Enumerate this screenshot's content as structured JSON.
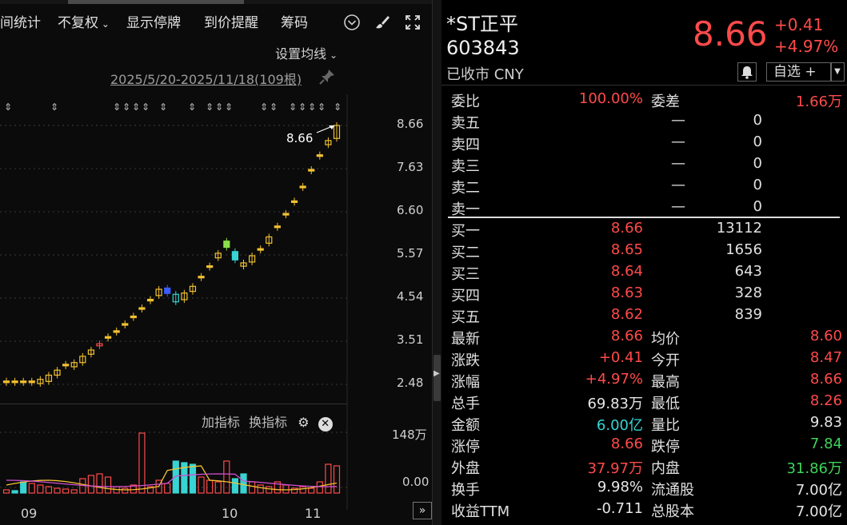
{
  "toolbar": {
    "items": [
      "间统计",
      "不复权",
      "显示停牌",
      "到价提醒",
      "筹码"
    ],
    "ma_setting": "设置均线",
    "date_range": "2025/5/20-2025/11/18(109根)"
  },
  "chart": {
    "price_ticks": [
      "8.66",
      "7.63",
      "6.60",
      "5.57",
      "4.54",
      "3.51",
      "2.48"
    ],
    "last_price_label": "8.66",
    "indicator_add": "加指标",
    "indicator_switch": "换指标",
    "volume_top": "148万",
    "volume_zero": "0.00",
    "x_labels": [
      "09",
      "10",
      "11"
    ],
    "expand": "»"
  },
  "chart_data": {
    "type": "candlestick",
    "ylim": [
      2.48,
      8.66
    ],
    "candles": [
      {
        "o": 2.56,
        "c": 2.56
      },
      {
        "o": 2.56,
        "c": 2.56
      },
      {
        "o": 2.56,
        "c": 2.56
      },
      {
        "o": 2.56,
        "c": 2.56
      },
      {
        "o": 2.5,
        "c": 2.6
      },
      {
        "o": 2.55,
        "c": 2.7
      },
      {
        "o": 2.7,
        "c": 2.82
      },
      {
        "o": 2.95,
        "c": 2.96
      },
      {
        "o": 2.9,
        "c": 3.0
      },
      {
        "o": 3.0,
        "c": 3.15
      },
      {
        "o": 3.2,
        "c": 3.3
      },
      {
        "o": 3.4,
        "c": 3.45
      },
      {
        "o": 3.6,
        "c": 3.62
      },
      {
        "o": 3.75,
        "c": 3.76
      },
      {
        "o": 3.92,
        "c": 3.93
      },
      {
        "o": 4.1,
        "c": 4.11
      },
      {
        "o": 4.3,
        "c": 4.31
      },
      {
        "o": 4.5,
        "c": 4.51
      },
      {
        "o": 4.6,
        "c": 4.75
      },
      {
        "o": 4.78,
        "c": 4.65
      },
      {
        "o": 4.45,
        "c": 4.63
      },
      {
        "o": 4.5,
        "c": 4.66
      },
      {
        "o": 4.7,
        "c": 4.82
      },
      {
        "o": 5.05,
        "c": 5.06
      },
      {
        "o": 5.3,
        "c": 5.31
      },
      {
        "o": 5.5,
        "c": 5.61
      },
      {
        "o": 5.9,
        "c": 5.75
      },
      {
        "o": 5.65,
        "c": 5.45
      },
      {
        "o": 5.3,
        "c": 5.38
      },
      {
        "o": 5.4,
        "c": 5.55
      },
      {
        "o": 5.7,
        "c": 5.72
      },
      {
        "o": 5.85,
        "c": 6.0
      },
      {
        "o": 6.25,
        "c": 6.26
      },
      {
        "o": 6.55,
        "c": 6.56
      },
      {
        "o": 6.85,
        "c": 6.86
      },
      {
        "o": 7.2,
        "c": 7.21
      },
      {
        "o": 7.6,
        "c": 7.61
      },
      {
        "o": 7.95,
        "c": 7.96
      },
      {
        "o": 8.2,
        "c": 8.3
      },
      {
        "o": 8.35,
        "c": 8.66
      }
    ],
    "volume_range": [
      0,
      1480000
    ]
  },
  "quote": {
    "name": "*ST正平",
    "code": "603843",
    "status": "已收市 CNY",
    "price": "8.66",
    "change": "+0.41",
    "change_pct": "+4.97%",
    "watch_label": "自选 +",
    "weibi_label": "委比",
    "weibi_value": "100.00%",
    "weicha_label": "委差",
    "weicha_value": "1.66万",
    "asks": [
      {
        "label": "卖五",
        "price": "—",
        "vol": "0"
      },
      {
        "label": "卖四",
        "price": "—",
        "vol": "0"
      },
      {
        "label": "卖三",
        "price": "—",
        "vol": "0"
      },
      {
        "label": "卖二",
        "price": "—",
        "vol": "0"
      },
      {
        "label": "卖一",
        "price": "—",
        "vol": "0"
      }
    ],
    "bids": [
      {
        "label": "买一",
        "price": "8.66",
        "vol": "13112"
      },
      {
        "label": "买二",
        "price": "8.65",
        "vol": "1656"
      },
      {
        "label": "买三",
        "price": "8.64",
        "vol": "643"
      },
      {
        "label": "买四",
        "price": "8.63",
        "vol": "328"
      },
      {
        "label": "买五",
        "price": "8.62",
        "vol": "839"
      }
    ],
    "stats": [
      {
        "l1": "最新",
        "v1": "8.66",
        "c1": "red",
        "l2": "均价",
        "v2": "8.60",
        "c2": "red"
      },
      {
        "l1": "涨跌",
        "v1": "+0.41",
        "c1": "red",
        "l2": "今开",
        "v2": "8.47",
        "c2": "red"
      },
      {
        "l1": "涨幅",
        "v1": "+4.97%",
        "c1": "red",
        "l2": "最高",
        "v2": "8.66",
        "c2": "red"
      },
      {
        "l1": "总手",
        "v1": "69.83万",
        "c1": "white",
        "l2": "最低",
        "v2": "8.26",
        "c2": "red"
      },
      {
        "l1": "金额",
        "v1": "6.00亿",
        "c1": "cyan",
        "l2": "量比",
        "v2": "9.83",
        "c2": "white"
      },
      {
        "l1": "涨停",
        "v1": "8.66",
        "c1": "red",
        "l2": "跌停",
        "v2": "7.84",
        "c2": "green"
      },
      {
        "l1": "外盘",
        "v1": "37.97万",
        "c1": "red",
        "l2": "内盘",
        "v2": "31.86万",
        "c2": "green"
      },
      {
        "l1": "换手",
        "v1": "9.98%",
        "c1": "white",
        "l2": "流通股",
        "v2": "7.00亿",
        "c2": "white"
      },
      {
        "l1": "收益TTM",
        "v1": "-0.711",
        "c1": "white",
        "l2": "总股本",
        "v2": "7.00亿",
        "c2": "white"
      }
    ]
  }
}
